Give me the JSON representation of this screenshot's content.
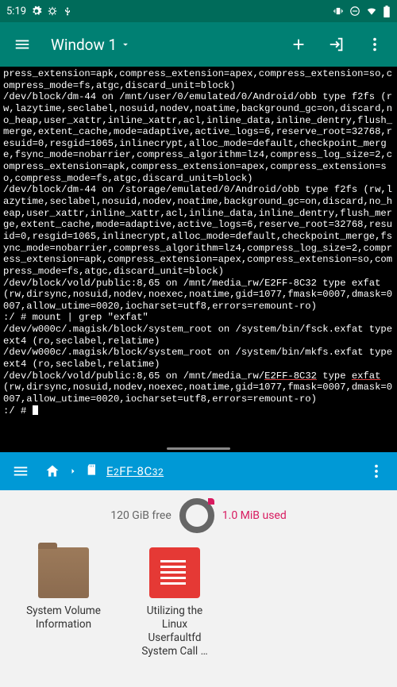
{
  "status": {
    "time": "5:19"
  },
  "appbar": {
    "title": "Window 1"
  },
  "terminal": {
    "text_a": "press_extension=apk,compress_extension=apex,compress_extension=so,compress_mode=fs,atgc,discard_unit=block)\n/dev/block/dm-44 on /mnt/user/0/emulated/0/Android/obb type f2fs (rw,lazytime,seclabel,nosuid,nodev,noatime,background_gc=on,discard,no_heap,user_xattr,inline_xattr,acl,inline_data,inline_dentry,flush_merge,extent_cache,mode=adaptive,active_logs=6,reserve_root=32768,resuid=0,resgid=1065,inlinecrypt,alloc_mode=default,checkpoint_merge,fsync_mode=nobarrier,compress_algorithm=lz4,compress_log_size=2,compress_extension=apk,compress_extension=apex,compress_extension=so,compress_mode=fs,atgc,discard_unit=block)\n/dev/block/dm-44 on /storage/emulated/0/Android/obb type f2fs (rw,lazytime,seclabel,nosuid,nodev,noatime,background_gc=on,discard,no_heap,user_xattr,inline_xattr,acl,inline_data,inline_dentry,flush_merge,extent_cache,mode=adaptive,active_logs=6,reserve_root=32768,resuid=0,resgid=1065,inlinecrypt,alloc_mode=default,checkpoint_merge,fsync_mode=nobarrier,compress_algorithm=lz4,compress_log_size=2,compress_extension=apk,compress_extension=apex,compress_extension=so,compress_mode=fs,atgc,discard_unit=block)\n/dev/block/vold/public:8,65 on /mnt/media_rw/E2FF-8C32 type exfat (rw,dirsync,nosuid,nodev,noexec,noatime,gid=1077,fmask=0007,dmask=0007,allow_utime=0020,iocharset=utf8,errors=remount-ro)\n:/ # mount | grep \"exfat\"\n/dev/w000c/.magisk/block/system_root on /system/bin/fsck.exfat type ext4 (ro,seclabel,relatime)\n/dev/w000c/.magisk/block/system_root on /system/bin/mkfs.exfat type ext4 (ro,seclabel,relatime)\n/dev/block/vold/public:8,65 on /mnt/media_rw/",
    "hl1": "E2FF-8C32",
    "mid": " type ",
    "hl2": "exfat",
    "text_b": " (rw,dirsync,nosuid,nodev,noexec,noatime,gid=1077,fmask=0007,dmask=0007,allow_utime=0020,iocharset=utf8,errors=remount-ro)\n:/ # "
  },
  "fm": {
    "crumb_a": "E",
    "crumb_b": "2",
    "crumb_c": "FF-8C",
    "crumb_d": "32",
    "storage": {
      "free": "120 GiB free",
      "used": "1.0 MiB used"
    },
    "files": [
      {
        "name": "System Volume Information",
        "type": "folder"
      },
      {
        "name": "Utilizing the Linux Userfaultfd System Call …",
        "type": "doc"
      }
    ]
  }
}
